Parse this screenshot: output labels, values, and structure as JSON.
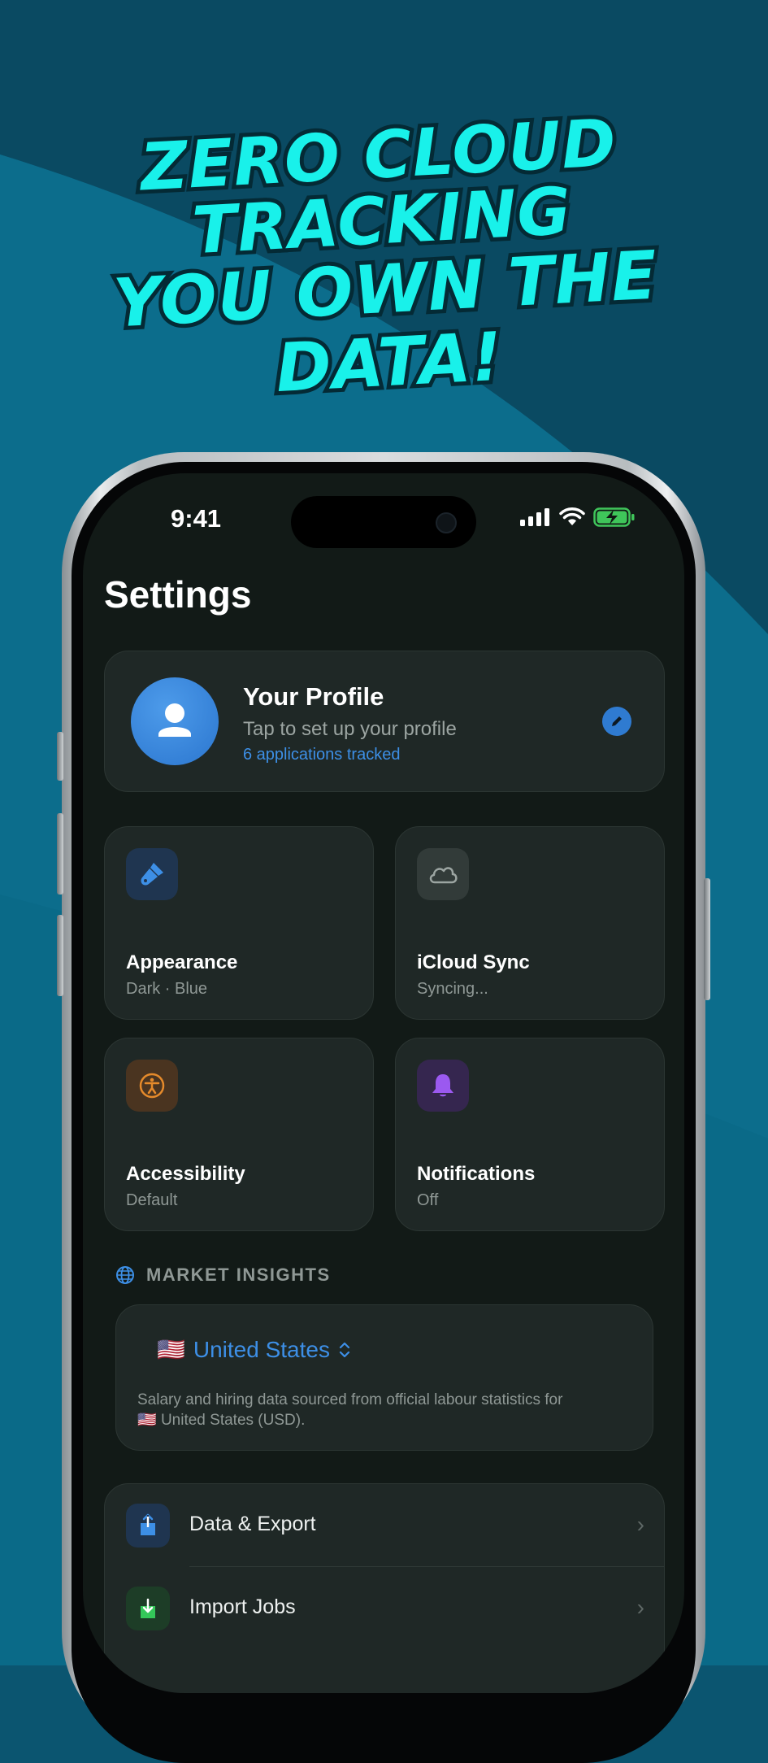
{
  "headline": {
    "line1": "ZERO CLOUD",
    "line2": "TRACKING",
    "line3": "YOU OWN THE DATA!"
  },
  "status_bar": {
    "time": "9:41"
  },
  "page": {
    "title": "Settings"
  },
  "profile": {
    "name": "Your Profile",
    "subtitle": "Tap to set up your profile",
    "tracked": "6 applications tracked"
  },
  "tiles": [
    {
      "title": "Appearance",
      "subtitle": "Dark · Blue",
      "icon": "paintbrush-icon",
      "color": "#3d8fe6"
    },
    {
      "title": "iCloud Sync",
      "subtitle": "Syncing...",
      "icon": "cloud-icon",
      "color": "#9ca5a2"
    },
    {
      "title": "Accessibility",
      "subtitle": "Default",
      "icon": "accessibility-icon",
      "color": "#e58a2b"
    },
    {
      "title": "Notifications",
      "subtitle": "Off",
      "icon": "bell-icon",
      "color": "#9b59f0"
    }
  ],
  "market": {
    "section_title": "MARKET INSIGHTS",
    "flag": "🇺🇸",
    "country": "United States",
    "note_prefix": "Salary and hiring data sourced from official labour statistics for",
    "note_flag": "🇺🇸",
    "note_country": "United States (USD)."
  },
  "list": [
    {
      "label": "Data & Export",
      "icon": "share-icon",
      "color": "#3d8fe6"
    },
    {
      "label": "Import Jobs",
      "icon": "import-icon",
      "color": "#34c759"
    }
  ],
  "colors": {
    "accent": "#3d8fe6",
    "headline": "#19f1ea",
    "screen_bg": "#121a17",
    "card_bg": "#1f2826"
  }
}
